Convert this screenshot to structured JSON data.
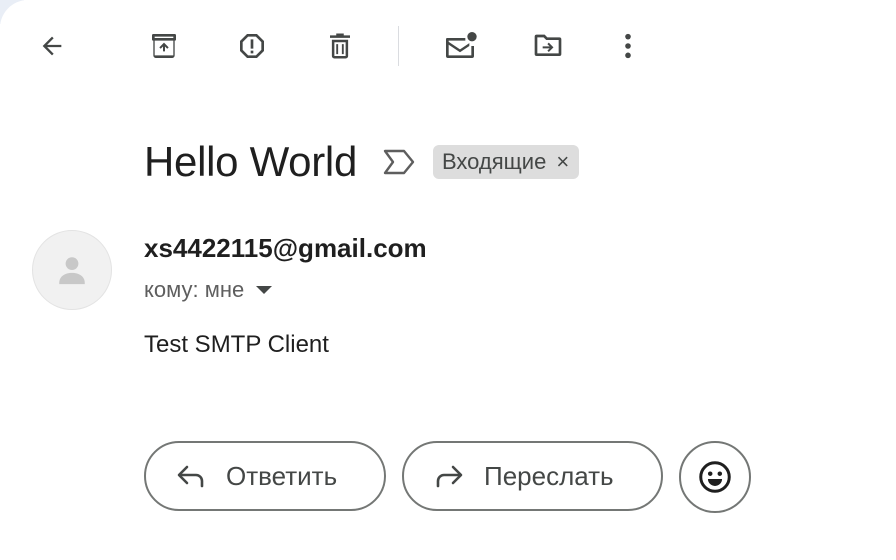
{
  "toolbar": {
    "back_icon": "arrow-left-icon",
    "archive_icon": "archive-icon",
    "report_spam_icon": "report-spam-icon",
    "delete_icon": "trash-icon",
    "mark_unread_icon": "mark-unread-icon",
    "move_to_icon": "move-to-folder-icon",
    "more_icon": "more-vert-icon"
  },
  "message": {
    "subject": "Hello World",
    "label": "Входящие",
    "label_remove": "×",
    "sender": "xs4422115@gmail.com",
    "recipient": "кому: мне",
    "body": "Test SMTP Client"
  },
  "actions": {
    "reply_label": "Ответить",
    "forward_label": "Переслать",
    "emoji_icon": "emoji-reaction-icon"
  },
  "colors": {
    "icon": "#444746",
    "text": "#1f1f1f",
    "chip_bg": "#dddddd",
    "outline": "#747775"
  }
}
